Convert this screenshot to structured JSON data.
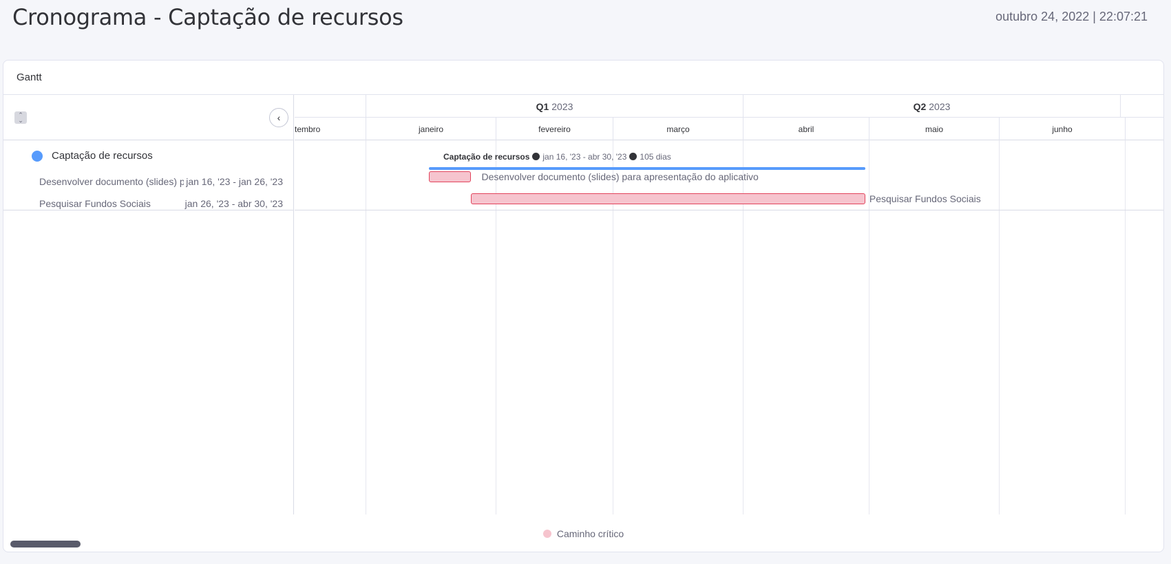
{
  "header": {
    "title": "Cronograma - Captação de recursos",
    "timestamp": "outubro 24, 2022 | 22:07:21"
  },
  "widget": {
    "title": "Gantt"
  },
  "left_panel": {
    "collapse_icon": "collapse-all-icon",
    "toggle_icon": "chevron-left-icon",
    "group": {
      "name": "Captação de recursos",
      "color": "#579bfc"
    },
    "tasks": [
      {
        "name": "Desenvolver documento (slides) para apresentação do aplicativo",
        "dates": "jan 16, '23 - jan 26, '23"
      },
      {
        "name": "Pesquisar Fundos Sociais",
        "dates": "jan 26, '23 - abr 30, '23"
      }
    ]
  },
  "timeline": {
    "quarters": [
      {
        "q": "Q1",
        "year": "2023"
      },
      {
        "q": "Q2",
        "year": "2023"
      }
    ],
    "months": [
      "tembro",
      "janeiro",
      "fevereiro",
      "março",
      "abril",
      "maio",
      "junho"
    ],
    "summary": {
      "name": "Captação de recursos",
      "dates": "jan 16, '23 - abr 30, '23",
      "duration": "105 dias",
      "start": "2023-01-16",
      "end": "2023-04-30",
      "color": "#579bfc"
    },
    "bars": [
      {
        "label": "Desenvolver documento (slides) para apresentação do aplicativo",
        "start": "2023-01-16",
        "end": "2023-01-26",
        "critical": true
      },
      {
        "label": "Pesquisar Fundos Sociais",
        "start": "2023-01-26",
        "end": "2023-04-30",
        "critical": true
      }
    ]
  },
  "legend": {
    "label": "Caminho crítico",
    "color": "#f6c4ce"
  }
}
